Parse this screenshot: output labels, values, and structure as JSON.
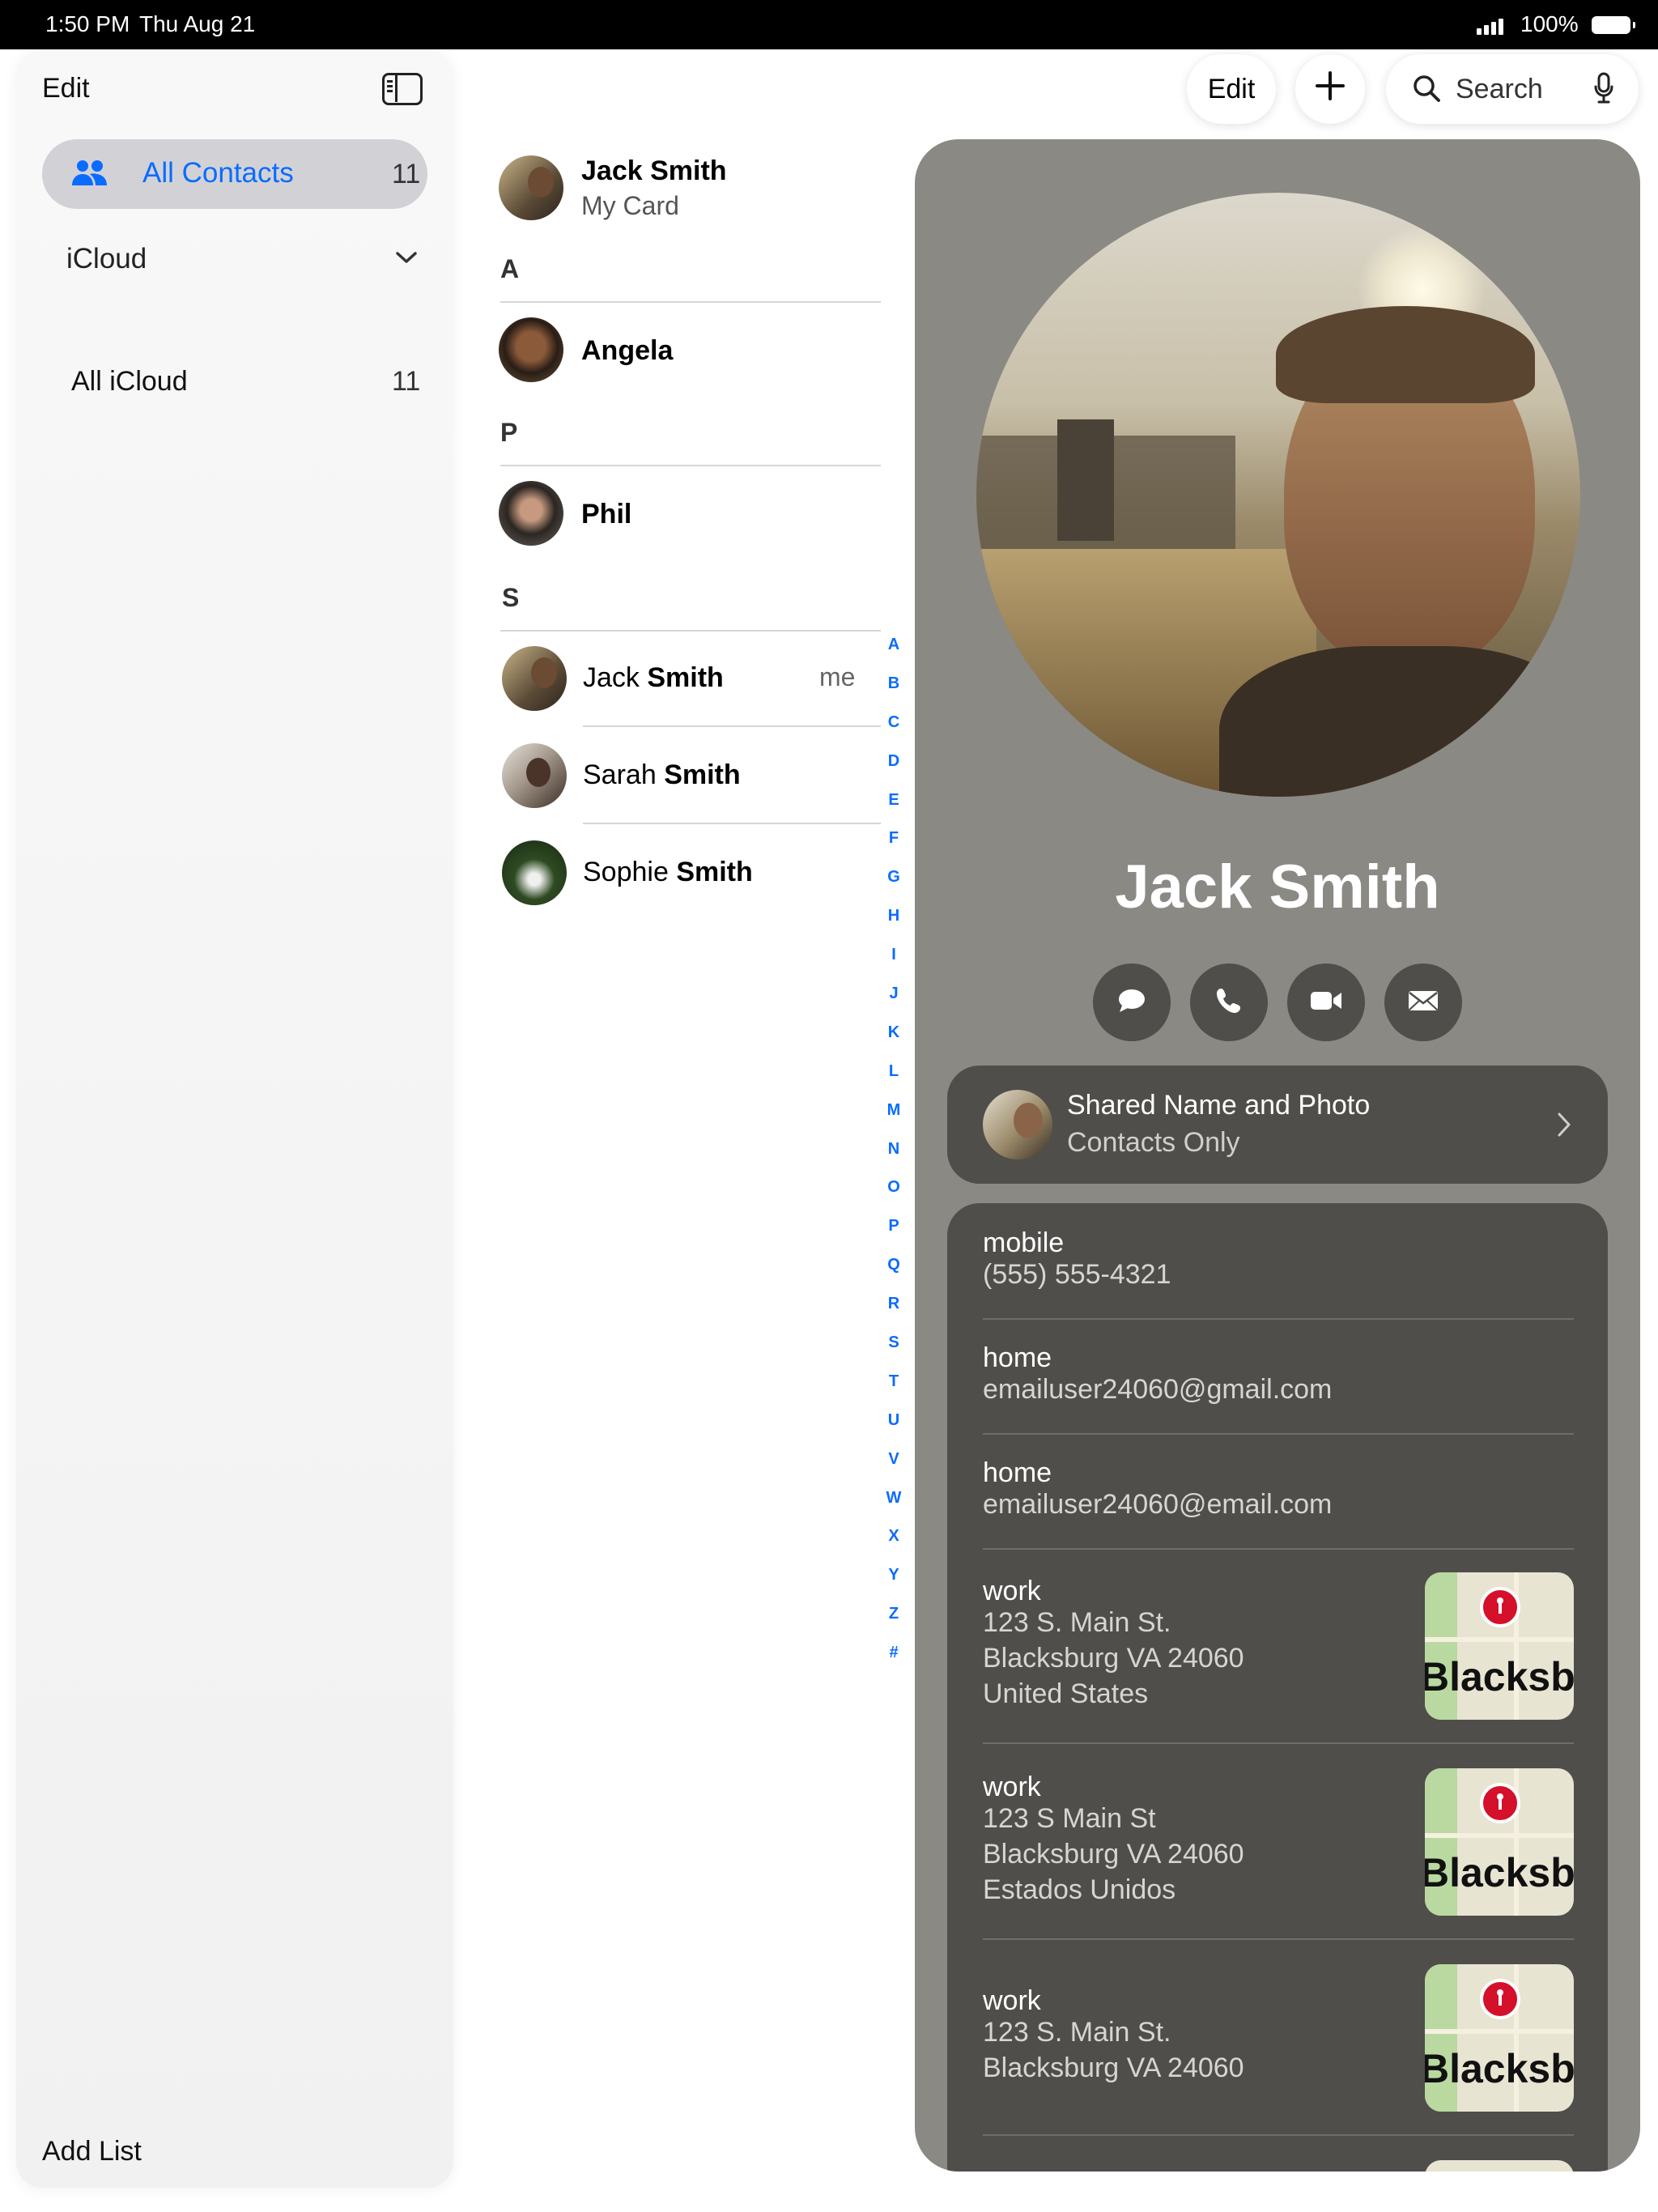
{
  "status_bar": {
    "time": "1:50 PM",
    "date": "Thu Aug 21",
    "battery": "100%"
  },
  "sidebar": {
    "edit_label": "Edit",
    "toggle_icon": "sidebar-icon",
    "all_contacts": {
      "label": "All Contacts",
      "count": "11",
      "icon": "person-2-icon"
    },
    "group_header": "iCloud",
    "group_items": [
      {
        "label": "All iCloud",
        "count": "11"
      }
    ],
    "add_list_label": "Add List"
  },
  "toolbar": {
    "edit_label": "Edit",
    "add_icon": "plus-icon",
    "search_placeholder": "Search",
    "mic_icon": "mic-icon"
  },
  "list": {
    "my_card": {
      "name_first": "Jack",
      "name_last": "Smith",
      "subtitle": "My Card"
    },
    "sections": [
      {
        "letter": "A",
        "contacts": [
          {
            "first": "Angela",
            "last": ""
          }
        ]
      },
      {
        "letter": "P",
        "contacts": [
          {
            "first": "Phil",
            "last": ""
          }
        ]
      },
      {
        "letter": "S",
        "contacts": [
          {
            "first": "Jack",
            "last": "Smith",
            "tag": "me"
          },
          {
            "first": "Sarah",
            "last": "Smith"
          },
          {
            "first": "Sophie",
            "last": "Smith"
          }
        ]
      }
    ],
    "index": [
      "A",
      "B",
      "C",
      "D",
      "E",
      "F",
      "G",
      "H",
      "I",
      "J",
      "K",
      "L",
      "M",
      "N",
      "O",
      "P",
      "Q",
      "R",
      "S",
      "T",
      "U",
      "V",
      "W",
      "X",
      "Y",
      "Z",
      "#"
    ]
  },
  "detail": {
    "name": "Jack Smith",
    "actions": [
      "message-icon",
      "phone-icon",
      "video-icon",
      "mail-icon"
    ],
    "shared": {
      "title": "Shared Name and Photo",
      "subtitle": "Contacts Only"
    },
    "fields": [
      {
        "label": "mobile",
        "value": "(555) 555-4321"
      },
      {
        "label": "home",
        "value": "emailuser24060@gmail.com"
      },
      {
        "label": "home",
        "value": "emailuser24060@email.com"
      }
    ],
    "addresses": [
      {
        "label": "work",
        "lines": [
          "123 S. Main St.",
          "Blacksburg VA 24060",
          "United States"
        ]
      },
      {
        "label": "work",
        "lines": [
          "123 S Main St",
          "Blacksburg VA 24060",
          "Estados Unidos"
        ]
      },
      {
        "label": "work",
        "lines": [
          "123 S. Main St.",
          "Blacksburg VA 24060"
        ]
      }
    ],
    "map_label": "Blacksburg"
  },
  "colors": {
    "accent": "#0a6cff",
    "detail_bg": "#8a8984",
    "card_bg": "#4f4e4a"
  }
}
